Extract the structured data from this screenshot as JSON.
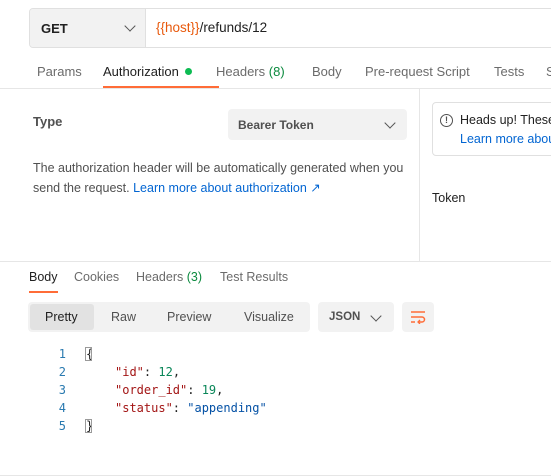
{
  "request": {
    "method": "GET",
    "url_variable": "{{host}}",
    "url_path": "/refunds/12"
  },
  "request_tabs": [
    {
      "label": "Params",
      "count": ""
    },
    {
      "label": "Authorization",
      "count": ""
    },
    {
      "label": "Headers",
      "count": "(8)"
    },
    {
      "label": "Body",
      "count": ""
    },
    {
      "label": "Pre-request Script",
      "count": ""
    },
    {
      "label": "Tests",
      "count": ""
    },
    {
      "label": "S",
      "count": ""
    }
  ],
  "auth": {
    "type_label": "Type",
    "type_value": "Bearer Token",
    "description": "The authorization header will be automatically generated when you send the request.",
    "learn_more": "Learn more about authorization ↗",
    "headsup_title": "Heads up! These",
    "headsup_link": "Learn more abou",
    "token_label": "Token"
  },
  "response_tabs": [
    {
      "label": "Body",
      "count": ""
    },
    {
      "label": "Cookies",
      "count": ""
    },
    {
      "label": "Headers",
      "count": "(3)"
    },
    {
      "label": "Test Results",
      "count": ""
    }
  ],
  "view_modes": [
    "Pretty",
    "Raw",
    "Preview",
    "Visualize"
  ],
  "format": "JSON",
  "body": {
    "line_numbers": [
      "1",
      "2",
      "3",
      "4",
      "5"
    ],
    "open_brace": "{",
    "close_brace": "}",
    "fields": [
      {
        "key": "\"id\"",
        "value": "12",
        "sep": ","
      },
      {
        "key": "\"order_id\"",
        "value": "19",
        "sep": ","
      },
      {
        "key": "\"status\"",
        "value": "\"appending\"",
        "sep": ""
      }
    ]
  },
  "colors": {
    "accent": "#ff6c37",
    "status_green": "#0cbb52",
    "count_green": "#0b8a3e",
    "link_blue": "#0265d2",
    "url_variable": "#e8590c"
  }
}
